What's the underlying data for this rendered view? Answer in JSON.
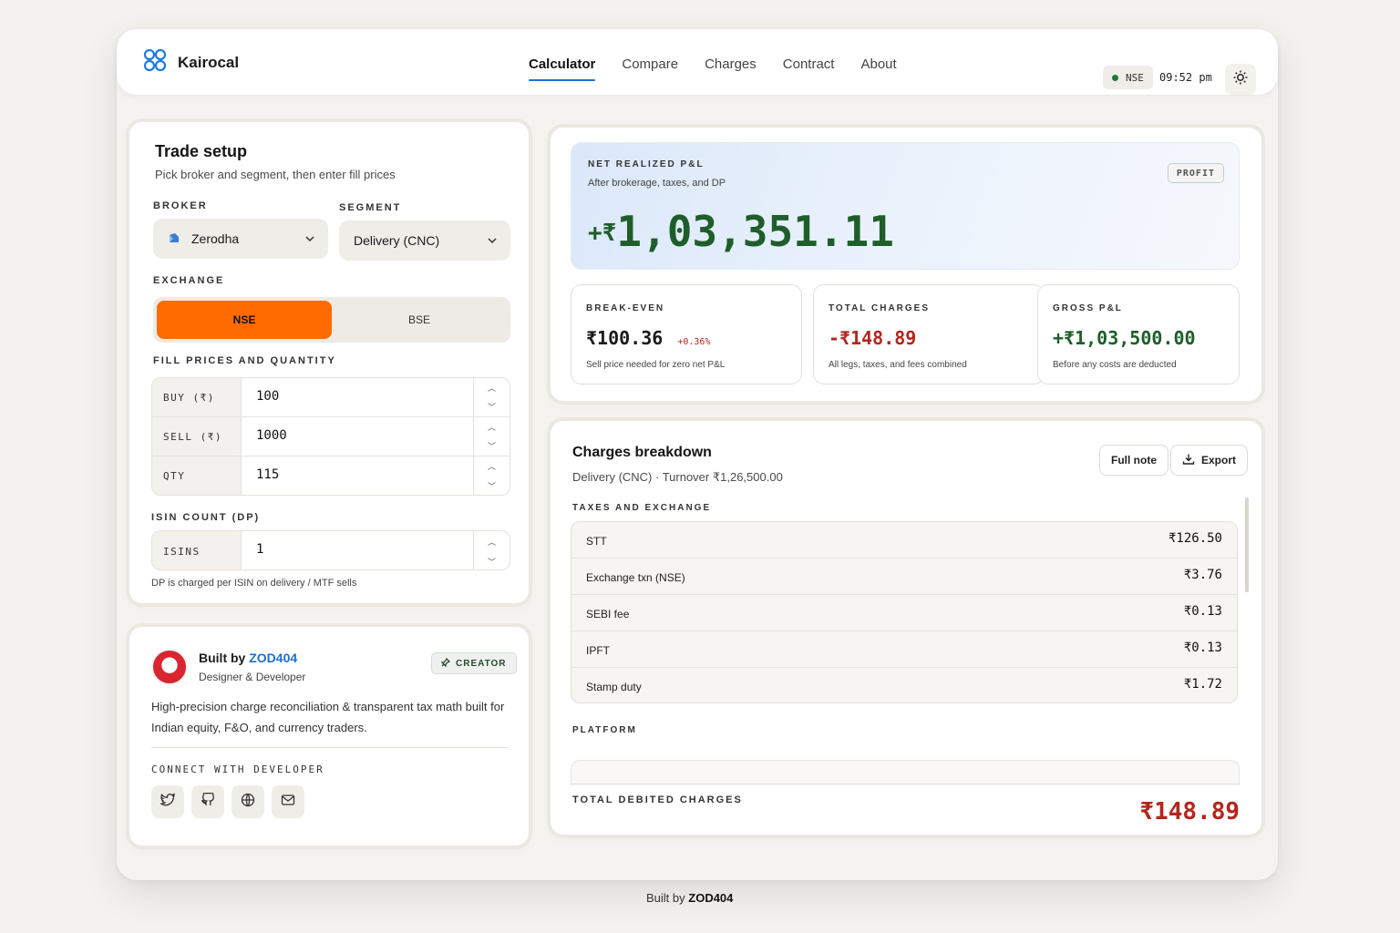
{
  "brand": {
    "name": "Kairocal"
  },
  "nav": [
    {
      "label": "Calculator",
      "active": true
    },
    {
      "label": "Compare"
    },
    {
      "label": "Charges"
    },
    {
      "label": "Contract"
    },
    {
      "label": "About"
    }
  ],
  "status": {
    "market": "NSE",
    "time": "09:52 pm"
  },
  "trade_setup": {
    "title": "Trade setup",
    "subtitle": "Pick broker and segment, then enter fill prices",
    "broker_label": "BROKER",
    "broker_value": "Zerodha",
    "segment_label": "SEGMENT",
    "segment_value": "Delivery (CNC)",
    "exchange_label": "EXCHANGE",
    "exchange_options": [
      "NSE",
      "BSE"
    ],
    "exchange_selected": "NSE",
    "fill_label": "FILL PRICES AND QUANTITY",
    "rows": [
      {
        "key": "BUY (₹)",
        "value": "100"
      },
      {
        "key": "SELL (₹)",
        "value": "1000"
      },
      {
        "key": "QTY",
        "value": "115"
      }
    ],
    "isin_label": "ISIN COUNT (DP)",
    "isin_key": "ISINS",
    "isin_value": "1",
    "isin_note": "DP is charged per ISIN on delivery / MTF sells"
  },
  "creator": {
    "built_by_prefix": "Built by",
    "built_by_name": "ZOD404",
    "role": "Designer & Developer",
    "badge": "CREATOR",
    "description": "High-precision charge reconciliation & transparent tax math built for Indian equity, F&O, and currency traders.",
    "connect_label": "CONNECT WITH DEVELOPER",
    "socials": [
      "twitter-icon",
      "github-icon",
      "globe-icon",
      "mail-icon"
    ]
  },
  "pnl": {
    "label": "NET REALIZED P&L",
    "sub": "After brokerage, taxes, and DP",
    "tag": "PROFIT",
    "sign": "+₹",
    "value": "1,03,351.11",
    "stats": [
      {
        "label": "BREAK-EVEN",
        "value": "₹100.36",
        "extra": "+0.36%",
        "desc": "Sell price needed for zero net P&L"
      },
      {
        "label": "TOTAL CHARGES",
        "value": "-₹148.89",
        "desc": "All legs, taxes, and fees combined"
      },
      {
        "label": "GROSS P&L",
        "value": "+₹1,03,500.00",
        "desc": "Before any costs are deducted"
      }
    ]
  },
  "charges": {
    "title": "Charges breakdown",
    "subtitle": "Delivery (CNC) · Turnover ₹1,26,500.00",
    "full_note": "Full note",
    "export": "Export",
    "taxes_label": "TAXES AND EXCHANGE",
    "taxes": [
      {
        "name": "STT",
        "value": "₹126.50"
      },
      {
        "name": "Exchange txn (NSE)",
        "value": "₹3.76"
      },
      {
        "name": "SEBI fee",
        "value": "₹0.13"
      },
      {
        "name": "IPFT",
        "value": "₹0.13"
      },
      {
        "name": "Stamp duty",
        "value": "₹1.72"
      }
    ],
    "platform_label": "PLATFORM",
    "total_label": "TOTAL DEBITED CHARGES",
    "total_value": "₹148.89"
  },
  "footer": {
    "prefix": "Built by",
    "name": "ZOD404"
  },
  "colors": {
    "accent": "#ff6b00",
    "profit": "#1f5e2a",
    "loss": "#b3261e",
    "link": "#1f6fcf"
  }
}
